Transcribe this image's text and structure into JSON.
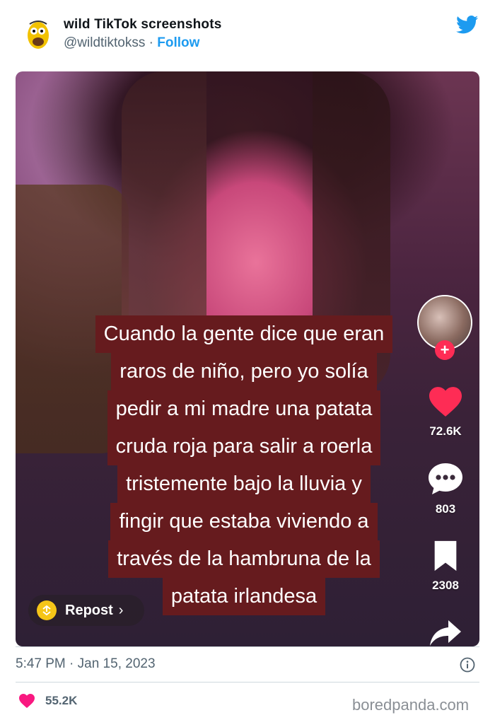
{
  "tweet": {
    "author_name": "wild TikTok screenshots",
    "author_handle": "@wildtiktokss",
    "separator": " · ",
    "follow_label": "Follow",
    "timestamp": "5:47 PM · Jan 15, 2023",
    "likes": "55.2K",
    "brand_color": "#1d9bf0",
    "like_color": "#f91880"
  },
  "tiktok": {
    "caption_lines": [
      "Cuando la gente dice que eran",
      "raros de niño, pero yo solía",
      "pedir a mi madre una patata",
      "cruda roja para salir a roerla",
      "tristemente bajo la lluvia y",
      "fingir que estaba viviendo a",
      "través de la hambruna de la",
      "patata irlandesa"
    ],
    "caption_bg": "#661b1e",
    "repost_label": "Repost",
    "likes": "72.6K",
    "comments": "803",
    "saves": "2308"
  },
  "watermark": "boredpanda.com"
}
